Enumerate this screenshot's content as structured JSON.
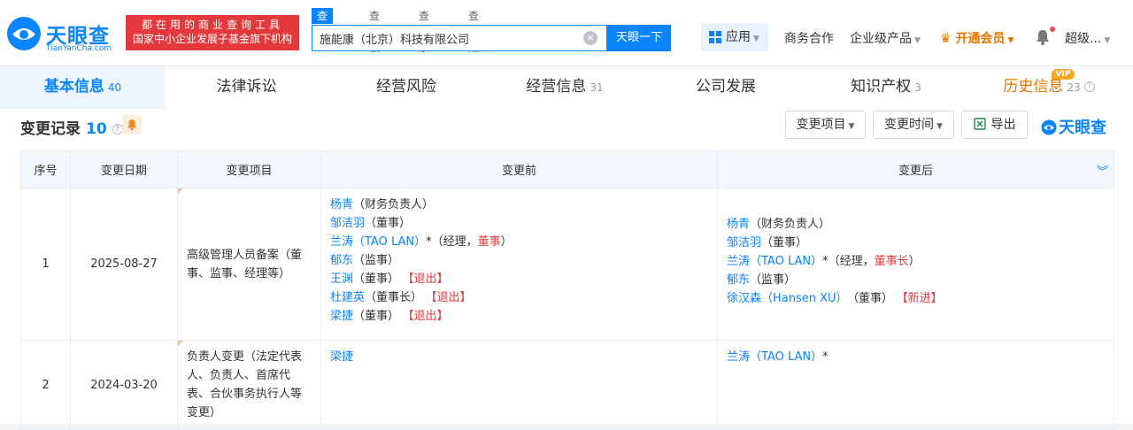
{
  "header": {
    "logo_title": "天眼查",
    "logo_sub": "TianYanCha.com",
    "banner_line1": "都在用的商业查询工具",
    "banner_line2": "国家中小企业发展子基金旗下机构",
    "search_tabs": [
      "查公司",
      "查老板",
      "查关系",
      "查风险"
    ],
    "search_value": "施能康（北京）科技有限公司",
    "search_button": "天眼一下",
    "apps": "应用",
    "nav": [
      "商务合作",
      "企业级产品"
    ],
    "vip": "开通会员",
    "user": "超级..."
  },
  "tabs": [
    {
      "label": "基本信息",
      "count": "40"
    },
    {
      "label": "法律诉讼",
      "count": ""
    },
    {
      "label": "经营风险",
      "count": ""
    },
    {
      "label": "经营信息",
      "count": "31"
    },
    {
      "label": "公司发展",
      "count": ""
    },
    {
      "label": "知识产权",
      "count": "3"
    },
    {
      "label": "历史信息",
      "count": "23"
    }
  ],
  "vip_badge": "VIP",
  "section": {
    "title": "变更记录",
    "count": "10",
    "filter_item": "变更项目",
    "filter_time": "变更时间",
    "export": "导出",
    "brand": "天眼查"
  },
  "table": {
    "headers": [
      "序号",
      "变更日期",
      "变更项目",
      "变更前",
      "变更后"
    ],
    "rows": [
      {
        "index": "1",
        "date": "2025-08-27",
        "item": "高级管理人员备案（董事、监事、经理等）",
        "before": [
          {
            "name": "杨青",
            "role": "（财务负责人）",
            "hl": "",
            "role_end": "",
            "tag": ""
          },
          {
            "name": "邹洁羽",
            "role": "（董事）",
            "hl": "",
            "role_end": "",
            "tag": ""
          },
          {
            "name": "兰涛（TAO LAN）",
            "role": "*（经理，",
            "hl": "董事",
            "role_end": "）",
            "tag": ""
          },
          {
            "name": "郁东",
            "role": "（监事）",
            "hl": "",
            "role_end": "",
            "tag": ""
          },
          {
            "name": "王渊",
            "role": "（董事）",
            "hl": "",
            "role_end": "",
            "tag": "【退出】"
          },
          {
            "name": "杜建英",
            "role": "（董事长）",
            "hl": "",
            "role_end": "",
            "tag": "【退出】"
          },
          {
            "name": "梁捷",
            "role": "（董事）",
            "hl": "",
            "role_end": "",
            "tag": "【退出】"
          }
        ],
        "after": [
          {
            "name": "杨青",
            "role": "（财务负责人）",
            "hl": "",
            "role_end": "",
            "tag": ""
          },
          {
            "name": "邹洁羽",
            "role": "（董事）",
            "hl": "",
            "role_end": "",
            "tag": ""
          },
          {
            "name": "兰涛（TAO LAN）",
            "role": "*（经理，",
            "hl": "董事长",
            "role_end": "）",
            "tag": ""
          },
          {
            "name": "郁东",
            "role": "（监事）",
            "hl": "",
            "role_end": "",
            "tag": ""
          },
          {
            "name": "徐汉森（Hansen XU）",
            "role": "（董事）",
            "hl": "",
            "role_end": "",
            "tag": "【新进】"
          }
        ]
      },
      {
        "index": "2",
        "date": "2024-03-20",
        "item": "负责人变更（法定代表人、负责人、首席代表、合伙事务执行人等变更）",
        "before": [
          {
            "name": "梁捷",
            "role": "",
            "hl": "",
            "role_end": "",
            "tag": ""
          }
        ],
        "after": [
          {
            "name": "兰涛（TAO LAN）",
            "role": "*",
            "hl": "",
            "role_end": "",
            "tag": ""
          }
        ]
      }
    ]
  },
  "colors": {
    "brand": "#0b84ff",
    "danger": "#e4393c",
    "vip": "#e87400"
  }
}
